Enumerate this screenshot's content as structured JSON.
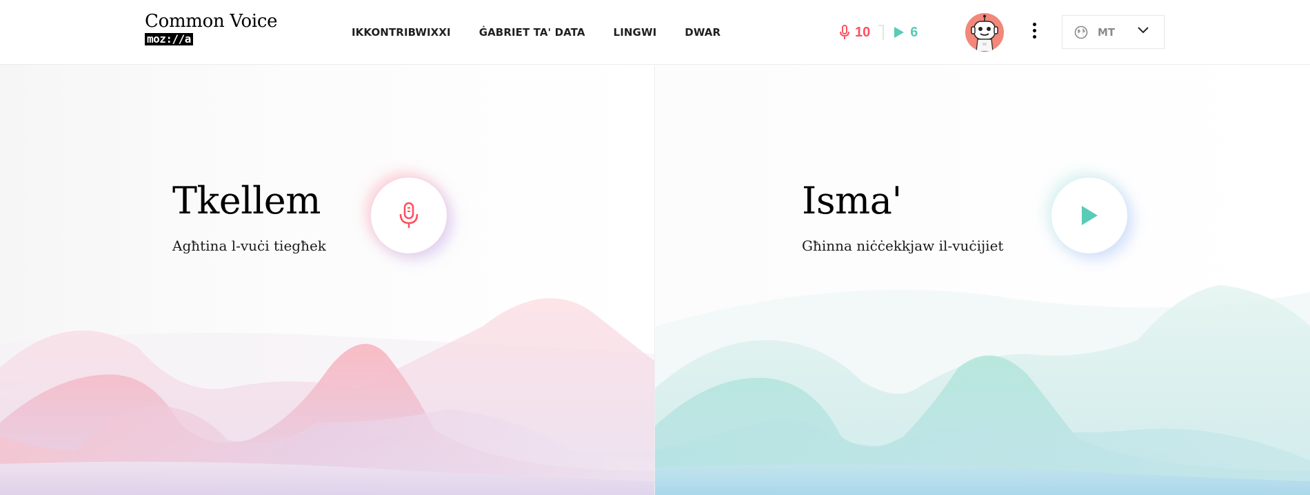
{
  "header": {
    "logo_title": "Common Voice",
    "logo_badge": "moz://a",
    "nav": [
      {
        "label": "IKKONTRIBWIXXI"
      },
      {
        "label": "ĠABRIET TA' DATA"
      },
      {
        "label": "LINGWI"
      },
      {
        "label": "DWAR"
      }
    ],
    "stats": {
      "recorded_count": "10",
      "validated_count": "6"
    },
    "language": {
      "code": "MT"
    }
  },
  "speak": {
    "title": "Tkellem",
    "subtitle": "Agħtina l-vuċi tiegħek"
  },
  "listen": {
    "title": "Isma'",
    "subtitle": "Għinna niċċekkjaw il-vuċijiet"
  },
  "colors": {
    "speak_accent": "#ff4f5e",
    "listen_accent": "#59cbb7",
    "avatar_bg": "#f2877a"
  },
  "icons": {
    "speak": "microphone-icon",
    "listen": "play-icon",
    "language": "globe-icon",
    "menu": "kebab-menu-icon",
    "dropdown": "chevron-down-icon",
    "avatar": "robot-avatar-icon"
  }
}
